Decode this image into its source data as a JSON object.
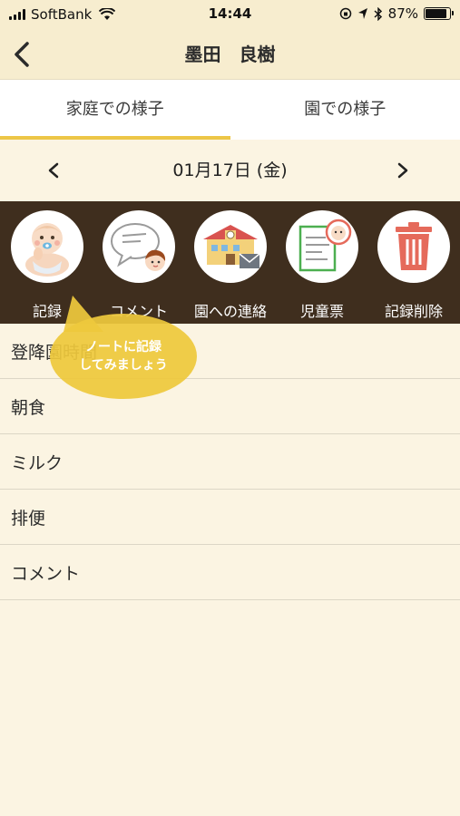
{
  "status_bar": {
    "carrier": "SoftBank",
    "time": "14:44",
    "battery_percent": "87%",
    "battery_level": 0.87
  },
  "nav": {
    "title": "墨田　良樹"
  },
  "tabs": [
    {
      "label": "家庭での様子",
      "active": true
    },
    {
      "label": "園での様子",
      "active": false
    }
  ],
  "date": {
    "prev_symbol": "<",
    "label": "01月17日 (金)",
    "next_symbol": ">"
  },
  "actions": [
    {
      "label": "記録",
      "icon": "baby-icon"
    },
    {
      "label": "コメント",
      "icon": "comment-bubble-icon"
    },
    {
      "label": "園への連絡",
      "icon": "school-mail-icon"
    },
    {
      "label": "児童票",
      "icon": "child-record-icon"
    },
    {
      "label": "記録削除",
      "icon": "trash-icon"
    }
  ],
  "records": [
    {
      "label": "登降園時間"
    },
    {
      "label": "朝食"
    },
    {
      "label": "ミルク"
    },
    {
      "label": "排便"
    },
    {
      "label": "コメント"
    }
  ],
  "tooltip": {
    "line1": "ノートに記録",
    "line2": "してみましょう"
  },
  "colors": {
    "header_bg": "#F7EDCF",
    "tab_indicator": "#EDC647",
    "toolbar_bg": "#3F2E1E",
    "tooltip": "#EEC83C",
    "trash": "#E56A5B"
  }
}
